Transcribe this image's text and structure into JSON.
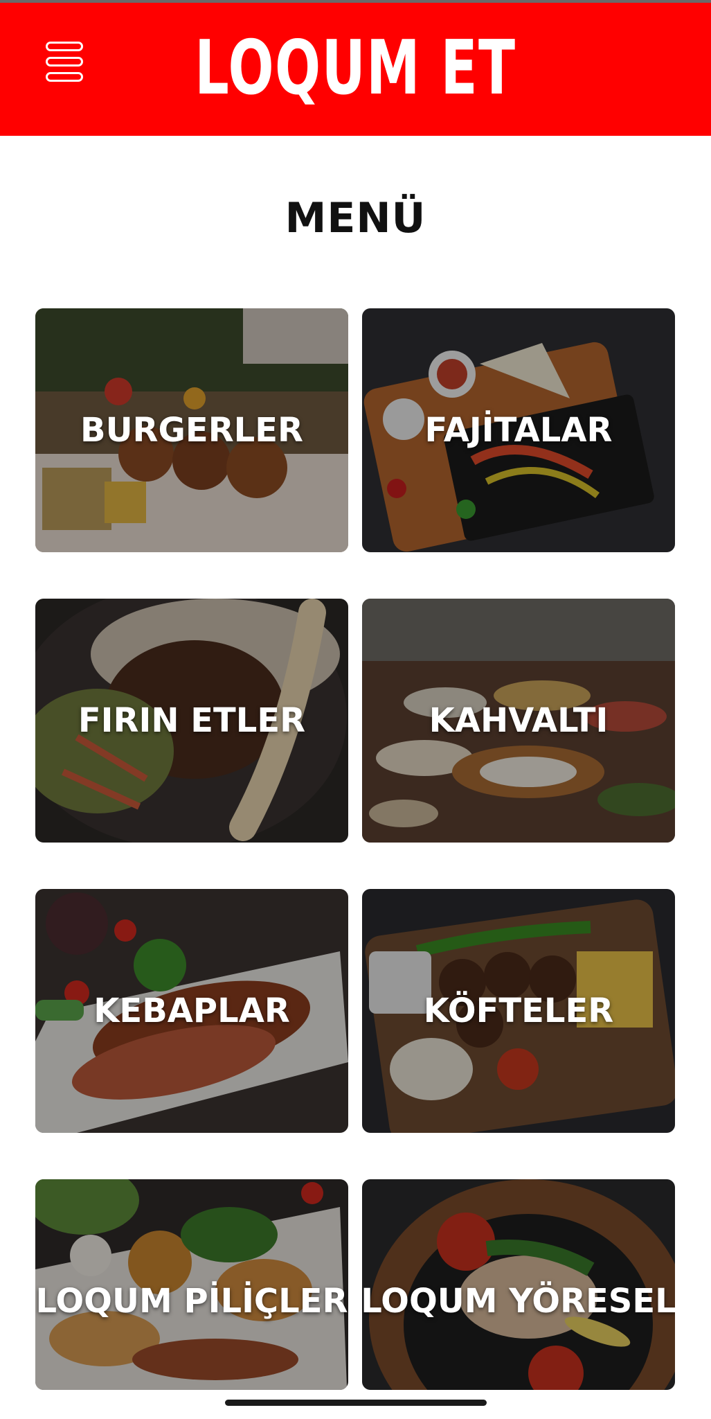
{
  "header": {
    "brand": "LOQUM ET",
    "menu_icon": "hamburger-menu-icon",
    "background_color": "#ff0000"
  },
  "page": {
    "title": "MENÜ"
  },
  "categories": [
    {
      "label": "BURGERLER"
    },
    {
      "label": "FAJİTALAR"
    },
    {
      "label": "FIRIN ETLER"
    },
    {
      "label": "KAHVALTI"
    },
    {
      "label": "KEBAPLAR"
    },
    {
      "label": "KÖFTELER"
    },
    {
      "label": "LOQUM PİLİÇLER"
    },
    {
      "label": "LOQUM YÖRESEL"
    }
  ]
}
